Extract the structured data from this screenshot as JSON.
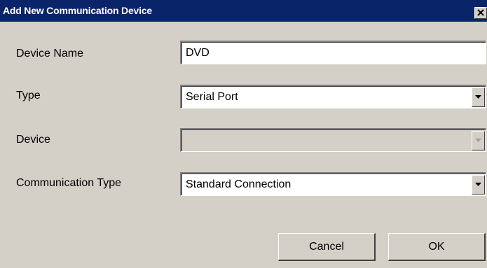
{
  "window": {
    "title": "Add New Communication Device"
  },
  "fields": {
    "device_name": {
      "label": "Device Name",
      "value": "DVD"
    },
    "type": {
      "label": "Type",
      "value": "Serial Port"
    },
    "device": {
      "label": "Device",
      "value": ""
    },
    "communication_type": {
      "label": "Communication Type",
      "value": "Standard Connection"
    }
  },
  "buttons": {
    "cancel": "Cancel",
    "ok": "OK"
  },
  "colors": {
    "titlebar": "#0a246a",
    "dialog_bg": "#d4d0c8"
  },
  "icons": {
    "close": "close-icon",
    "dropdown": "chevron-down-icon"
  }
}
